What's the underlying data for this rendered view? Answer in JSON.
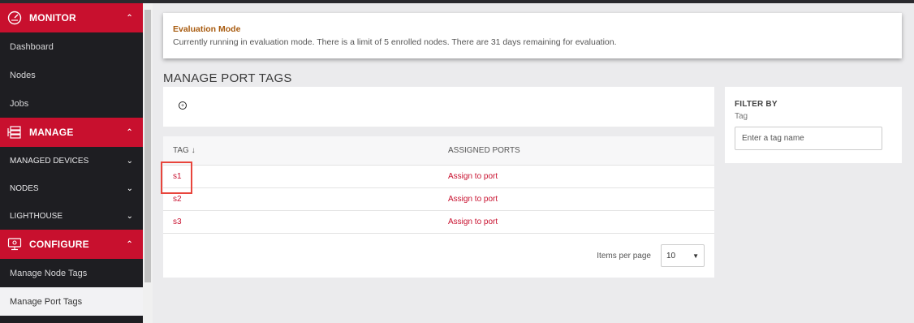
{
  "sidebar": {
    "monitor": {
      "title": "MONITOR",
      "items": [
        "Dashboard",
        "Nodes",
        "Jobs"
      ]
    },
    "manage": {
      "title": "MANAGE",
      "groups": [
        "MANAGED DEVICES",
        "NODES",
        "LIGHTHOUSE"
      ]
    },
    "configure": {
      "title": "CONFIGURE",
      "items": [
        "Manage Node Tags",
        "Manage Port Tags"
      ]
    }
  },
  "banner": {
    "title": "Evaluation Mode",
    "text": "Currently running in evaluation mode. There is a limit of 5 enrolled nodes. There are 31 days remaining for evaluation."
  },
  "page_title": "MANAGE PORT TAGS",
  "table": {
    "col_tag": "TAG ↓",
    "col_ports": "ASSIGNED PORTS",
    "rows": [
      {
        "tag": "s1",
        "ports": "Assign to port"
      },
      {
        "tag": "s2",
        "ports": "Assign to port"
      },
      {
        "tag": "s3",
        "ports": "Assign to port"
      }
    ],
    "items_per_page_label": "Items per page",
    "items_per_page_value": "10"
  },
  "filter": {
    "title": "FILTER BY",
    "label": "Tag",
    "placeholder": "Enter a tag name"
  },
  "colors": {
    "accent": "#c8102e",
    "sidebar_bg": "#1e1e22",
    "banner_title": "#a85b0f",
    "highlight": "#e8453c"
  }
}
